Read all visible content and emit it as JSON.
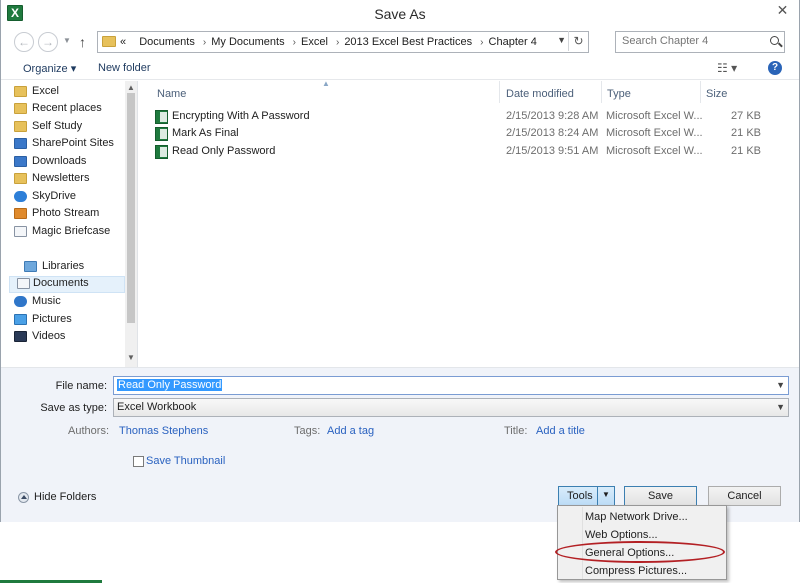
{
  "window": {
    "title": "Save As",
    "close_glyph": "✕"
  },
  "nav": {
    "back_glyph": "←",
    "forward_glyph": "→",
    "up_glyph": "↑",
    "breadcrumb_lead": "«",
    "breadcrumbs": [
      "Documents",
      "My Documents",
      "Excel",
      "2013 Excel Best Practices",
      "Chapter 4"
    ],
    "search_placeholder": "Search Chapter 4"
  },
  "toolbar": {
    "organize_label": "Organize ▾",
    "new_folder_label": "New folder",
    "help_glyph": "?"
  },
  "sidebar": {
    "items": [
      {
        "label": "Excel",
        "icon": "folder-icon"
      },
      {
        "label": "Recent places",
        "icon": "recent-places-icon"
      },
      {
        "label": "Self Study",
        "icon": "folder-icon"
      },
      {
        "label": "SharePoint Sites",
        "icon": "sharepoint-icon"
      },
      {
        "label": "Downloads",
        "icon": "downloads-icon"
      },
      {
        "label": "Newsletters",
        "icon": "folder-icon"
      },
      {
        "label": "SkyDrive",
        "icon": "skydrive-icon"
      },
      {
        "label": "Photo Stream",
        "icon": "photo-stream-icon"
      },
      {
        "label": "Magic Briefcase",
        "icon": "briefcase-icon"
      },
      {
        "label": "Libraries",
        "icon": "libraries-icon"
      },
      {
        "label": "Documents",
        "icon": "documents-icon"
      },
      {
        "label": "Music",
        "icon": "music-icon"
      },
      {
        "label": "Pictures",
        "icon": "pictures-icon"
      },
      {
        "label": "Videos",
        "icon": "videos-icon"
      }
    ],
    "selected": "Documents"
  },
  "filelist": {
    "columns": [
      "Name",
      "Date modified",
      "Type",
      "Size"
    ],
    "rows": [
      {
        "name": "Encrypting With A Password",
        "date": "2/15/2013 9:28 AM",
        "type": "Microsoft Excel W...",
        "size": "27 KB"
      },
      {
        "name": "Mark As Final",
        "date": "2/15/2013 8:24 AM",
        "type": "Microsoft Excel W...",
        "size": "21 KB"
      },
      {
        "name": "Read Only Password",
        "date": "2/15/2013 9:51 AM",
        "type": "Microsoft Excel W...",
        "size": "21 KB"
      }
    ]
  },
  "form": {
    "filename_label": "File name:",
    "filename_value": "Read Only Password",
    "savetype_label": "Save as type:",
    "savetype_value": "Excel Workbook",
    "authors_label": "Authors:",
    "authors_value": "Thomas Stephens",
    "tags_label": "Tags:",
    "tags_value": "Add a tag",
    "title_label": "Title:",
    "title_value": "Add a title",
    "thumbnail_label": "Save Thumbnail",
    "hide_folders_label": "Hide Folders"
  },
  "buttons": {
    "tools": "Tools",
    "save": "Save",
    "cancel": "Cancel"
  },
  "tools_menu": [
    "Map Network Drive...",
    "Web Options...",
    "General Options...",
    "Compress Pictures..."
  ],
  "colors": {
    "accent": "#3399ff",
    "link": "#2a62c0",
    "highlight_ring": "#b32024",
    "excel_green": "#1f7a3e"
  }
}
